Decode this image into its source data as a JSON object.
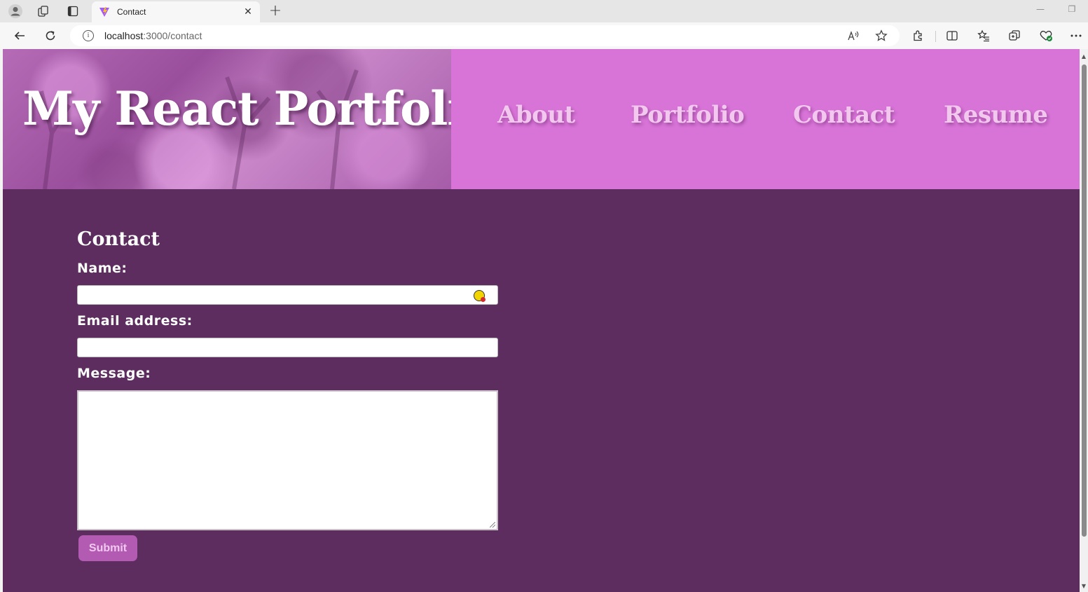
{
  "browser": {
    "tab": {
      "title": "Contact"
    },
    "address": {
      "host": "localhost",
      "path": ":3000/contact"
    },
    "icons": [
      "profile-icon",
      "workspaces-icon",
      "tab-actions-icon",
      "vite-favicon-icon",
      "close-icon",
      "new-tab-icon",
      "minimize-icon",
      "restore-icon",
      "back-icon",
      "refresh-icon",
      "site-info-icon",
      "read-aloud-icon",
      "favorite-star-icon",
      "extensions-icon",
      "split-screen-icon",
      "favorites-icon",
      "collections-icon",
      "browser-essentials-icon",
      "more-icon"
    ]
  },
  "header": {
    "title": "My React Portfolio",
    "nav": [
      {
        "label": "About"
      },
      {
        "label": "Portfolio"
      },
      {
        "label": "Contact"
      },
      {
        "label": "Resume"
      }
    ]
  },
  "contact": {
    "heading": "Contact",
    "name_label": "Name:",
    "name_value": "",
    "email_label": "Email address:",
    "email_value": "",
    "message_label": "Message:",
    "message_value": "",
    "submit_label": "Submit"
  },
  "colors": {
    "page_bg": "#5c2d5e",
    "header_bg": "#d873d8",
    "nav_text": "#f2c8ef",
    "submit_bg": "#b35ab3"
  }
}
